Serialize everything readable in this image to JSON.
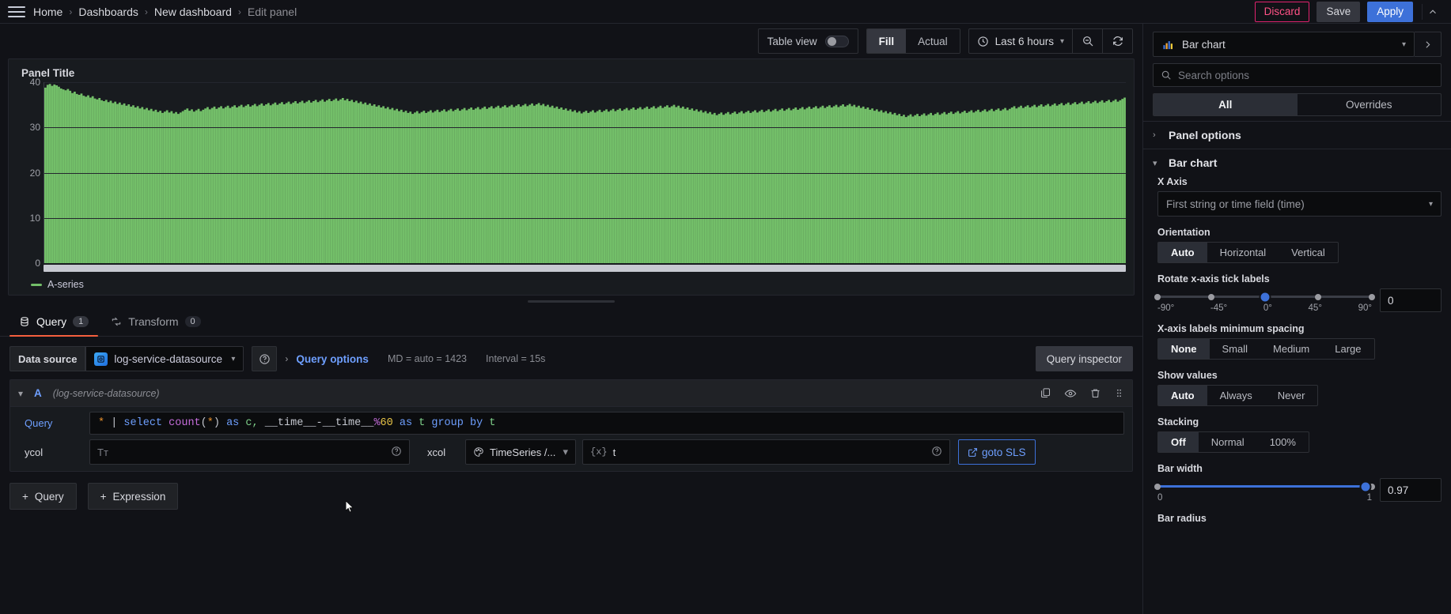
{
  "breadcrumb": {
    "items": [
      {
        "label": "Home",
        "active": false
      },
      {
        "label": "Dashboards",
        "active": false
      },
      {
        "label": "New dashboard",
        "active": false
      },
      {
        "label": "Edit panel",
        "active": true
      }
    ],
    "separator": "›"
  },
  "header_actions": {
    "discard_label": "Discard",
    "save_label": "Save",
    "apply_label": "Apply",
    "collapse_icon": "chevron-up-icon"
  },
  "panel_toolbar": {
    "table_view_label": "Table view",
    "table_view_on": false,
    "fill_actual": {
      "options": [
        "Fill",
        "Actual"
      ],
      "selected": "Fill"
    },
    "time_range": "Last 6 hours",
    "zoom_out_icon": "zoom-out-icon",
    "refresh_icon": "refresh-icon"
  },
  "panel": {
    "title": "Panel Title",
    "legend": [
      {
        "label": "A-series",
        "color": "#73bf69"
      }
    ]
  },
  "chart_data": {
    "type": "bar",
    "title": "Panel Title",
    "xlabel": "",
    "ylabel": "",
    "ylim": [
      0,
      40
    ],
    "yticks": [
      0,
      10,
      20,
      30,
      40
    ],
    "grid": true,
    "legend_position": "bottom",
    "series": [
      {
        "name": "A-series",
        "color": "#73bf69",
        "values": [
          38.8,
          39.4,
          39.6,
          39.2,
          39.5,
          39.3,
          39.0,
          38.6,
          38.4,
          38.2,
          38.5,
          38.1,
          37.6,
          37.9,
          37.4,
          37.2,
          37.5,
          37.0,
          36.8,
          37.1,
          36.6,
          36.9,
          36.4,
          36.2,
          36.5,
          36.0,
          35.8,
          36.1,
          35.6,
          35.9,
          35.4,
          35.7,
          35.2,
          35.5,
          35.0,
          35.3,
          34.8,
          35.1,
          34.6,
          34.9,
          34.4,
          34.7,
          34.2,
          34.5,
          34.0,
          34.3,
          33.8,
          34.1,
          33.6,
          33.9,
          33.4,
          33.7,
          33.2,
          33.5,
          33.8,
          33.3,
          33.6,
          33.1,
          33.4,
          33.0,
          33.3,
          33.6,
          33.9,
          34.2,
          33.7,
          34.0,
          33.5,
          33.8,
          34.1,
          33.6,
          33.9,
          34.2,
          34.5,
          34.0,
          34.3,
          34.6,
          34.1,
          34.4,
          34.7,
          34.2,
          34.5,
          34.8,
          34.3,
          34.6,
          34.9,
          34.4,
          34.7,
          35.0,
          34.5,
          34.8,
          35.1,
          34.6,
          34.9,
          35.2,
          34.7,
          35.0,
          35.3,
          34.8,
          35.1,
          35.4,
          34.9,
          35.2,
          35.5,
          35.0,
          35.3,
          35.6,
          35.1,
          35.4,
          35.7,
          35.2,
          35.5,
          35.8,
          35.3,
          35.6,
          35.9,
          35.4,
          35.7,
          36.0,
          35.5,
          35.8,
          36.1,
          35.6,
          35.9,
          36.2,
          35.7,
          36.0,
          36.3,
          35.8,
          36.1,
          36.4,
          35.9,
          36.2,
          36.5,
          36.0,
          36.3,
          35.8,
          36.1,
          35.6,
          35.9,
          35.4,
          35.7,
          35.2,
          35.5,
          35.0,
          35.3,
          34.8,
          35.1,
          34.6,
          34.9,
          34.4,
          34.7,
          34.2,
          34.5,
          34.0,
          34.3,
          33.8,
          34.1,
          33.6,
          33.9,
          33.4,
          33.7,
          33.2,
          33.5,
          33.0,
          33.3,
          33.6,
          33.1,
          33.4,
          33.7,
          33.2,
          33.5,
          33.8,
          33.3,
          33.6,
          33.9,
          33.4,
          33.7,
          34.0,
          33.5,
          33.8,
          34.1,
          33.6,
          33.9,
          34.2,
          33.7,
          34.0,
          34.3,
          33.8,
          34.1,
          34.4,
          33.9,
          34.2,
          34.5,
          34.0,
          34.3,
          34.6,
          34.1,
          34.4,
          34.7,
          34.2,
          34.5,
          34.8,
          34.3,
          34.6,
          34.9,
          34.4,
          34.7,
          35.0,
          34.5,
          34.8,
          35.1,
          34.6,
          34.9,
          35.2,
          34.7,
          35.0,
          35.3,
          34.8,
          35.1,
          35.4,
          34.9,
          35.2,
          34.7,
          35.0,
          34.5,
          34.8,
          34.3,
          34.6,
          34.1,
          34.4,
          33.9,
          34.2,
          33.7,
          34.0,
          33.5,
          33.8,
          33.3,
          33.6,
          33.1,
          33.4,
          33.7,
          33.2,
          33.5,
          33.8,
          33.3,
          33.6,
          33.9,
          33.4,
          33.7,
          34.0,
          33.5,
          33.8,
          34.1,
          33.6,
          33.9,
          34.2,
          33.7,
          34.0,
          34.3,
          33.8,
          34.1,
          34.4,
          33.9,
          34.2,
          34.5,
          34.0,
          34.3,
          34.6,
          34.1,
          34.4,
          34.7,
          34.2,
          34.5,
          34.8,
          34.3,
          34.6,
          34.9,
          34.4,
          34.7,
          35.0,
          34.5,
          34.8,
          34.3,
          34.6,
          34.1,
          34.4,
          33.9,
          34.2,
          33.7,
          34.0,
          33.5,
          33.8,
          33.3,
          33.6,
          33.1,
          33.4,
          32.9,
          33.2,
          32.7,
          33.0,
          33.3,
          32.8,
          33.1,
          33.4,
          32.9,
          33.2,
          33.5,
          33.0,
          33.3,
          33.6,
          33.1,
          33.4,
          33.7,
          33.2,
          33.5,
          33.8,
          33.3,
          33.6,
          33.9,
          33.4,
          33.7,
          34.0,
          33.5,
          33.8,
          34.1,
          33.6,
          33.9,
          34.2,
          33.7,
          34.0,
          34.3,
          33.8,
          34.1,
          34.4,
          33.9,
          34.2,
          34.5,
          34.0,
          34.3,
          34.6,
          34.1,
          34.4,
          34.7,
          34.2,
          34.5,
          34.8,
          34.3,
          34.6,
          34.9,
          34.4,
          34.7,
          35.0,
          34.5,
          34.8,
          35.1,
          34.6,
          34.9,
          35.2,
          34.7,
          35.0,
          34.5,
          34.8,
          34.3,
          34.6,
          34.1,
          34.4,
          33.9,
          34.2,
          33.7,
          34.0,
          33.5,
          33.8,
          33.3,
          33.6,
          33.1,
          33.4,
          32.9,
          33.2,
          32.7,
          33.0,
          32.5,
          32.8,
          32.3,
          32.6,
          32.9,
          32.4,
          32.7,
          33.0,
          32.5,
          32.8,
          33.1,
          32.6,
          32.9,
          33.2,
          32.7,
          33.0,
          33.3,
          32.8,
          33.1,
          33.4,
          32.9,
          33.2,
          33.5,
          33.0,
          33.3,
          33.6,
          33.1,
          33.4,
          33.7,
          33.2,
          33.5,
          33.8,
          33.3,
          33.6,
          33.9,
          33.4,
          33.7,
          34.0,
          33.5,
          33.8,
          34.1,
          33.6,
          33.9,
          34.2,
          33.7,
          34.0,
          34.3,
          33.8,
          34.1,
          34.4,
          34.7,
          34.2,
          34.5,
          34.8,
          34.3,
          34.6,
          34.9,
          34.4,
          34.7,
          35.0,
          34.5,
          34.8,
          35.1,
          34.6,
          34.9,
          35.2,
          34.7,
          35.0,
          35.3,
          34.8,
          35.1,
          35.4,
          34.9,
          35.2,
          35.5,
          35.0,
          35.3,
          35.6,
          35.1,
          35.4,
          35.7,
          35.2,
          35.5,
          35.8,
          35.3,
          35.6,
          35.9,
          35.4,
          35.7,
          36.0,
          35.5,
          35.8,
          36.1,
          35.6,
          35.9,
          36.2,
          35.7,
          36.0,
          36.3,
          36.6
        ]
      }
    ]
  },
  "query_tabs": [
    {
      "label": "Query",
      "badge": "1",
      "icon": "database-icon",
      "active": true
    },
    {
      "label": "Transform",
      "badge": "0",
      "icon": "transform-icon",
      "active": false
    }
  ],
  "datasource_row": {
    "label": "Data source",
    "selected": "log-service-datasource",
    "help_icon": "help-circle-icon",
    "query_options_label": "Query options",
    "max_data_points": "MD = auto = 1423",
    "interval": "Interval = 15s",
    "query_inspector_label": "Query inspector"
  },
  "query": {
    "ref_id": "A",
    "datasource_note": "(log-service-datasource)",
    "row_icons": [
      "duplicate-icon",
      "eye-icon",
      "trash-icon",
      "drag-handle-icon"
    ],
    "query_label": "Query",
    "sql_tokens": [
      {
        "t": "*",
        "c": "tok-star"
      },
      {
        "t": " | ",
        "c": "tok-pipe"
      },
      {
        "t": "select ",
        "c": "tok-kw"
      },
      {
        "t": "count",
        "c": "tok-fn"
      },
      {
        "t": "(",
        "c": "tok-id"
      },
      {
        "t": "*",
        "c": "tok-star"
      },
      {
        "t": ") ",
        "c": "tok-id"
      },
      {
        "t": "as ",
        "c": "tok-kw"
      },
      {
        "t": "c, ",
        "c": "tok-t"
      },
      {
        "t": "__time__-__time__",
        "c": "tok-id"
      },
      {
        "t": "%",
        "c": "tok-fn"
      },
      {
        "t": "60",
        "c": "tok-num"
      },
      {
        "t": " as ",
        "c": "tok-kw"
      },
      {
        "t": "t ",
        "c": "tok-t"
      },
      {
        "t": "group by ",
        "c": "tok-kw"
      },
      {
        "t": "t",
        "c": "tok-t"
      }
    ],
    "ycol_label": "ycol",
    "ycol_placeholder": "Tᴛ",
    "ycol_value": "",
    "xcol_label": "xcol",
    "format_value": "TimeSeries /...",
    "xcol_value": "t",
    "xcol_prefix": "{x}",
    "goto_sls_label": "goto SLS"
  },
  "add_buttons": [
    {
      "label": "Query",
      "icon": "plus-icon"
    },
    {
      "label": "Expression",
      "icon": "plus-icon"
    }
  ],
  "options_pane": {
    "viz_name": "Bar chart",
    "viz_icon": "bar-chart-icon",
    "next_icon": "chevron-right-icon",
    "search_placeholder": "Search options",
    "search_value": "",
    "tabs": {
      "options": [
        "All",
        "Overrides"
      ],
      "selected": "All"
    },
    "sections": [
      {
        "title": "Panel options",
        "expanded": false
      },
      {
        "title": "Bar chart",
        "expanded": true
      }
    ],
    "bar_chart": {
      "x_axis_label": "X Axis",
      "x_axis_value": "First string or time field (time)",
      "orientation_label": "Orientation",
      "orientation": {
        "options": [
          "Auto",
          "Horizontal",
          "Vertical"
        ],
        "selected": "Auto"
      },
      "rotate_label": "Rotate x-axis tick labels",
      "rotate_marks": [
        "-90°",
        "-45°",
        "0°",
        "45°",
        "90°"
      ],
      "rotate_value": "0",
      "spacing_label": "X-axis labels minimum spacing",
      "spacing": {
        "options": [
          "None",
          "Small",
          "Medium",
          "Large"
        ],
        "selected": "None"
      },
      "show_values_label": "Show values",
      "show_values": {
        "options": [
          "Auto",
          "Always",
          "Never"
        ],
        "selected": "Auto"
      },
      "stacking_label": "Stacking",
      "stacking": {
        "options": [
          "Off",
          "Normal",
          "100%"
        ],
        "selected": "Off"
      },
      "bar_width_label": "Bar width",
      "bar_width_min": "0",
      "bar_width_max": "1",
      "bar_width_value": "0.97",
      "bar_radius_label": "Bar radius"
    }
  },
  "colors": {
    "accent_blue": "#3d71d9",
    "series_green": "#73bf69",
    "tab_orange": "#f55f3e",
    "danger_pink": "#e0226e"
  }
}
